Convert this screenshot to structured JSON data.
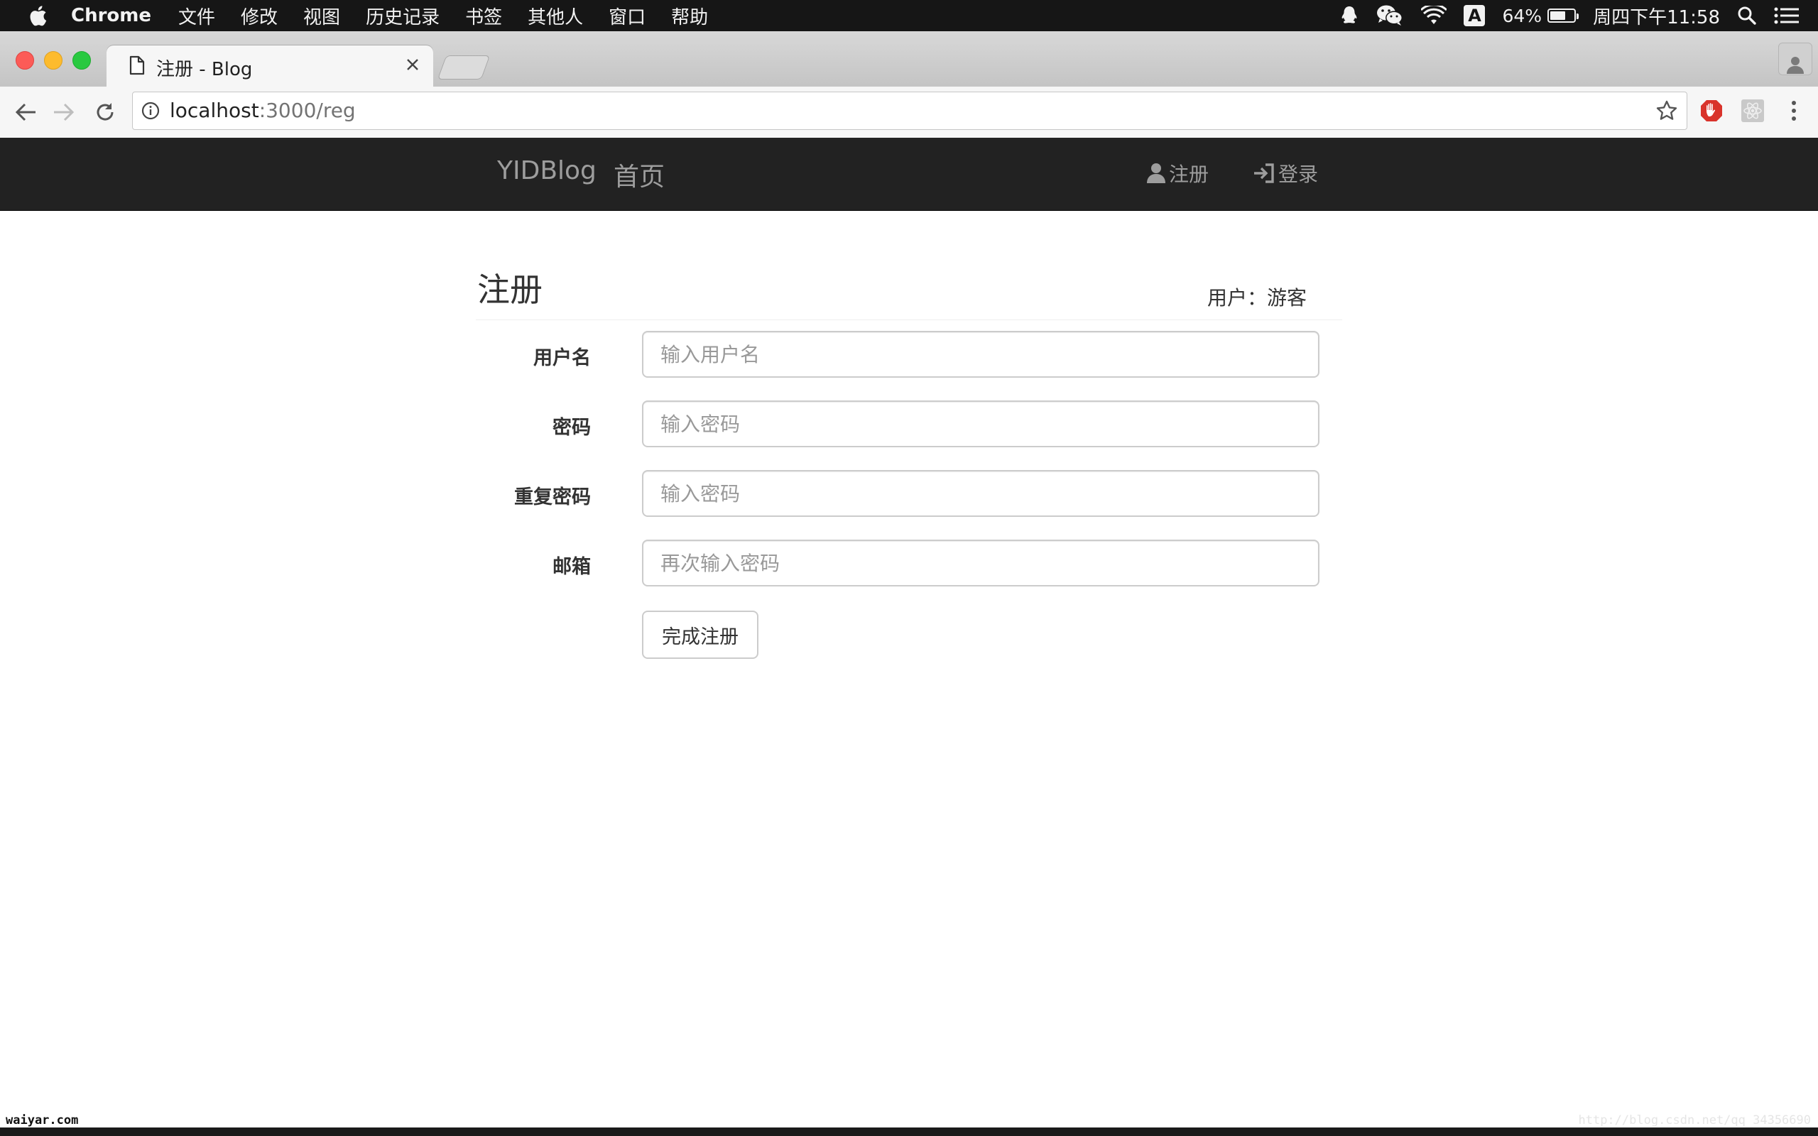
{
  "menubar": {
    "app_name": "Chrome",
    "items": [
      "文件",
      "修改",
      "视图",
      "历史记录",
      "书签",
      "其他人",
      "窗口",
      "帮助"
    ],
    "ime_label": "A",
    "battery_text": "64%",
    "battery_level": 0.64,
    "clock": "周四下午11:58"
  },
  "browser": {
    "tab_title": "注册 - Blog",
    "url_host": "localhost",
    "url_path": ":3000/reg"
  },
  "navbar": {
    "brand": "YIDBlog",
    "home": "首页",
    "register": "注册",
    "login": "登录"
  },
  "page": {
    "title": "注册",
    "user_status": "用户：游客"
  },
  "form": {
    "fields": [
      {
        "label": "用户名",
        "placeholder": "输入用户名",
        "value": ""
      },
      {
        "label": "密码",
        "placeholder": "输入密码",
        "value": ""
      },
      {
        "label": "重复密码",
        "placeholder": "输入密码",
        "value": ""
      },
      {
        "label": "邮箱",
        "placeholder": "再次输入密码",
        "value": ""
      }
    ],
    "submit_label": "完成注册"
  },
  "watermarks": {
    "left": "waiyar.com",
    "right": "http://blog.csdn.net/qq_34356690"
  },
  "colors": {
    "navbar_bg": "#222222",
    "navbar_text": "#9d9d9d",
    "menubar_bg": "#161616",
    "input_border": "#cccccc",
    "placeholder": "#999999"
  }
}
